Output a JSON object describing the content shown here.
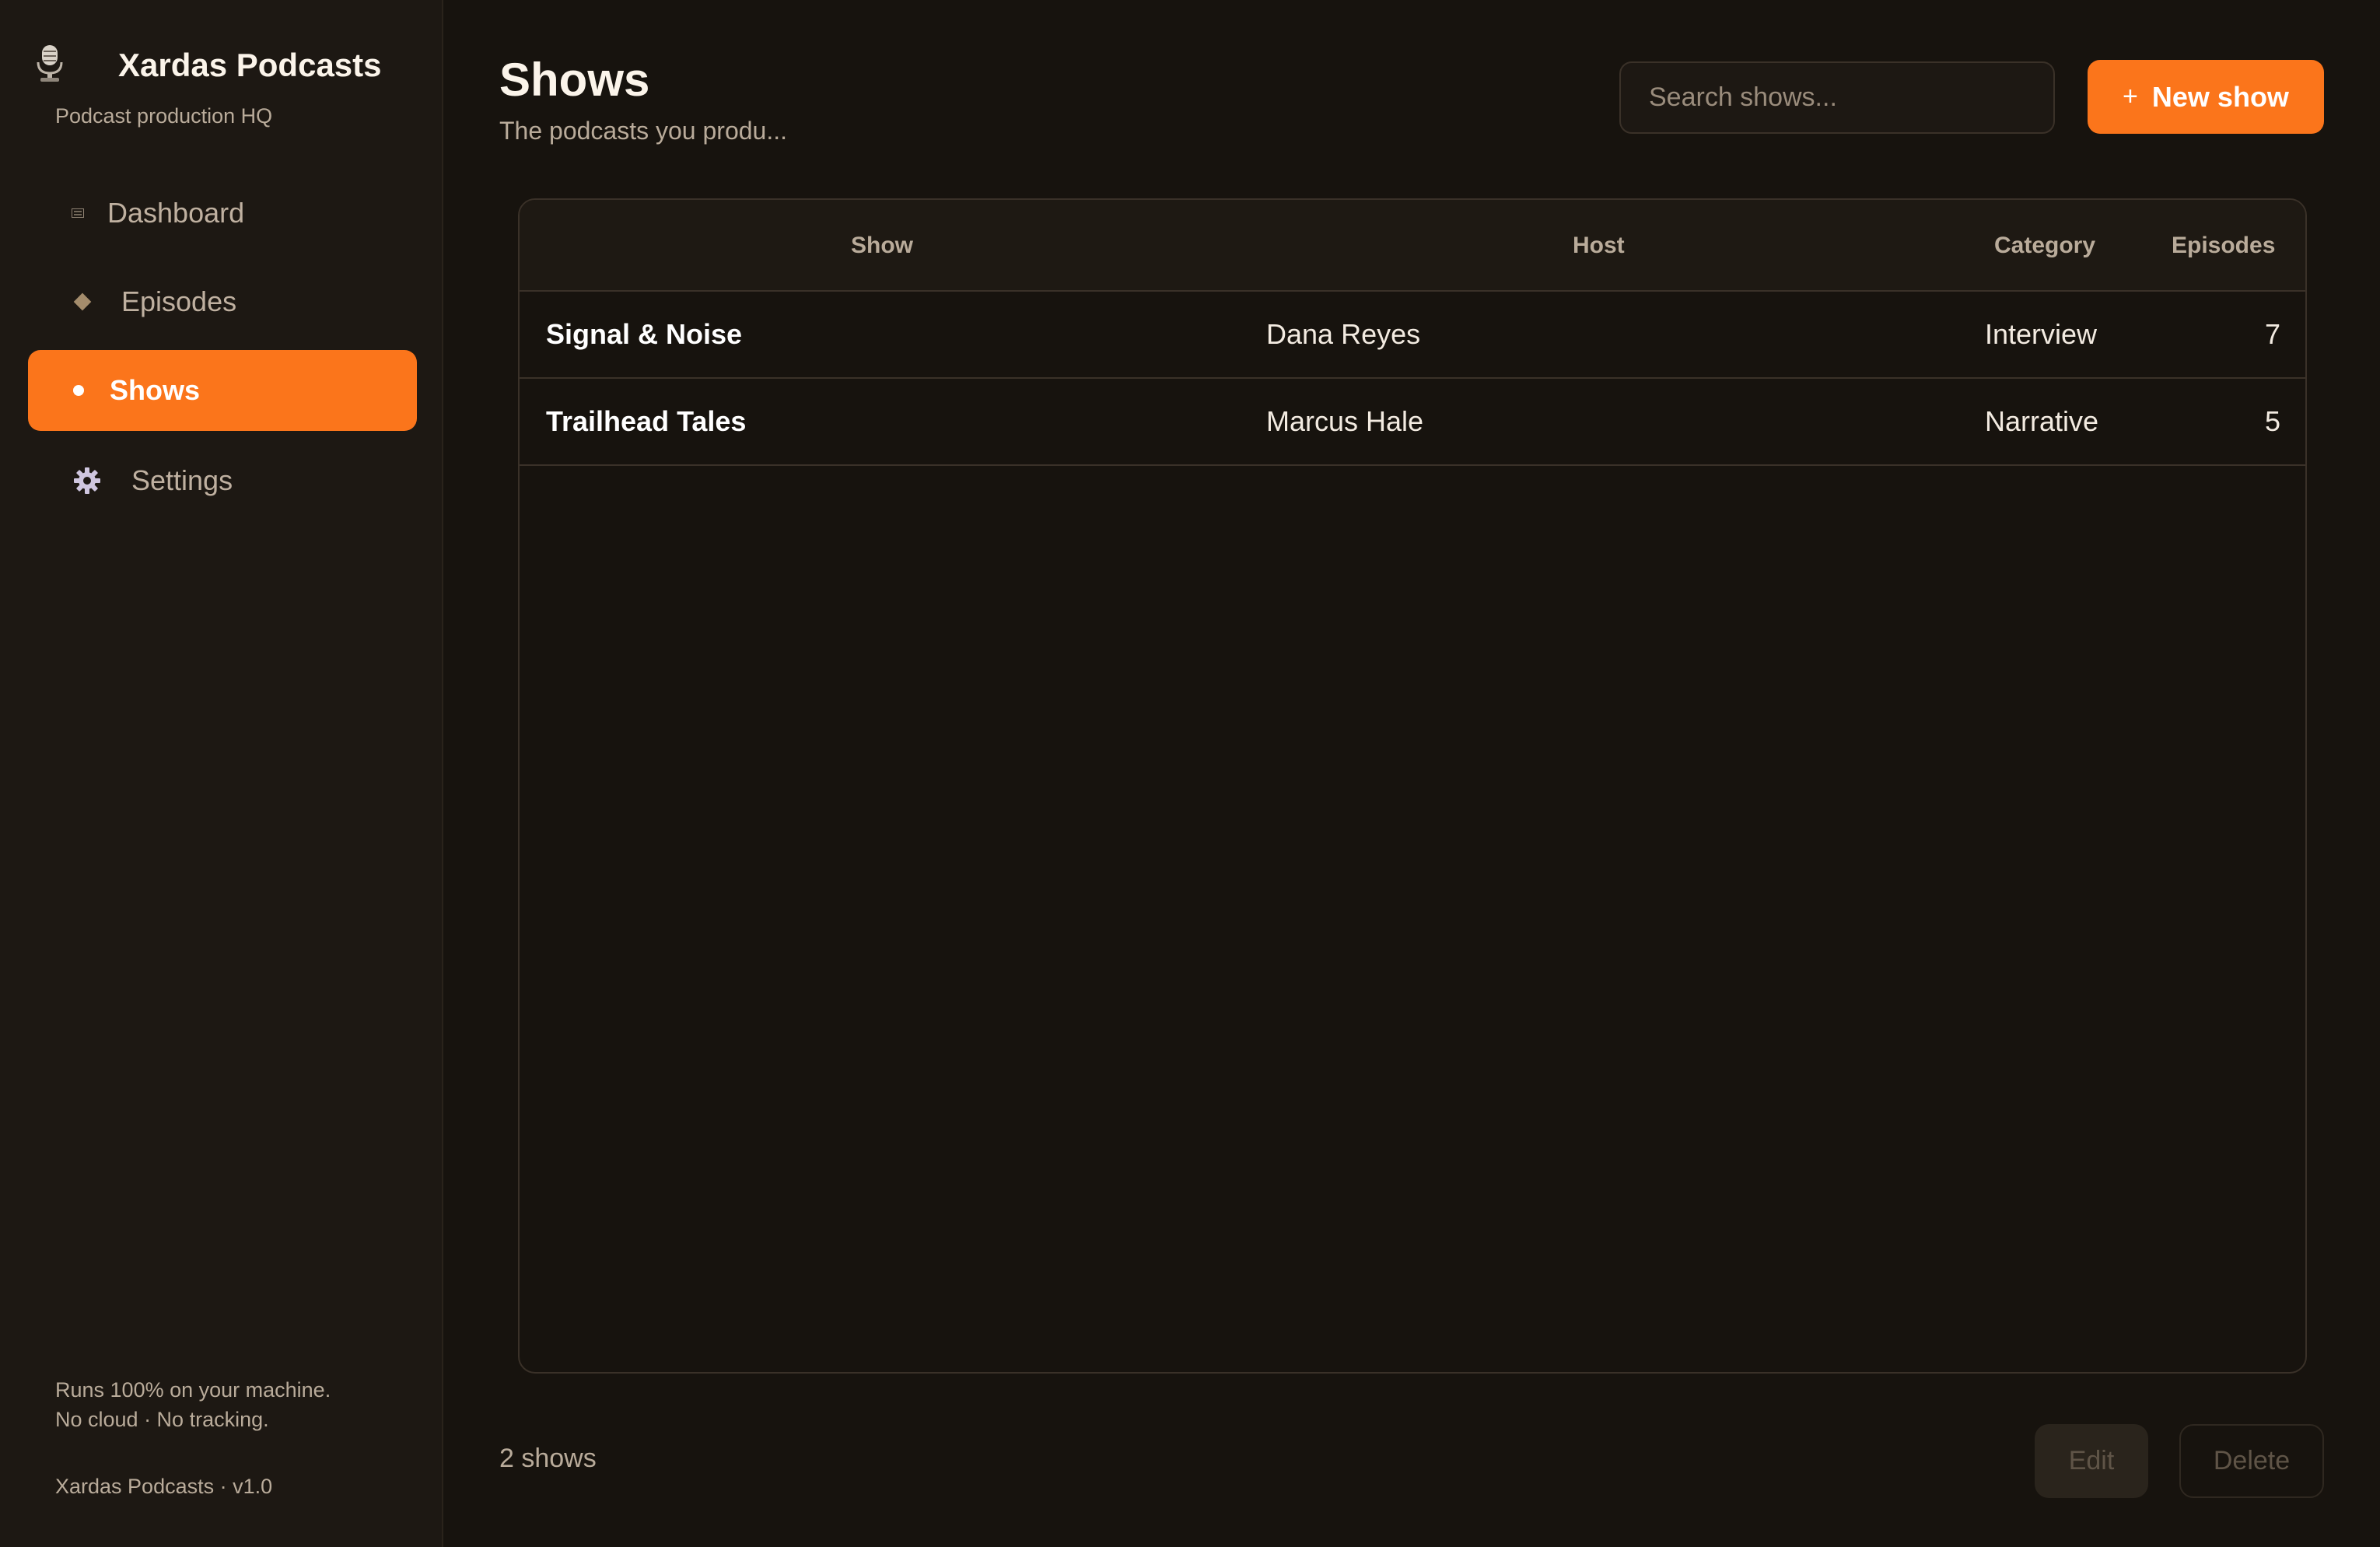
{
  "brand": {
    "title": "Xardas Podcasts",
    "subtitle": "Podcast production HQ",
    "icon": "microphone-icon"
  },
  "sidebar": {
    "items": [
      {
        "label": "Dashboard",
        "icon": "dashboard-icon",
        "active": false
      },
      {
        "label": "Episodes",
        "icon": "diamond-icon",
        "active": false
      },
      {
        "label": "Shows",
        "icon": "dot-icon",
        "active": true
      },
      {
        "label": "Settings",
        "icon": "gear-icon",
        "active": false
      }
    ],
    "note_line1": "Runs 100% on your machine.",
    "note_line2": "No cloud · No tracking.",
    "version": "Xardas Podcasts · v1.0"
  },
  "header": {
    "title": "Shows",
    "subtitle": "The podcasts you produ...",
    "search_placeholder": "Search shows...",
    "new_button_icon": "+",
    "new_button_label": "New show"
  },
  "table": {
    "columns": [
      "Show",
      "Host",
      "Category",
      "Episodes"
    ],
    "rows": [
      {
        "show": "Signal & Noise",
        "host": "Dana Reyes",
        "category": "Interview",
        "episodes": "7"
      },
      {
        "show": "Trailhead Tales",
        "host": "Marcus Hale",
        "category": "Narrative",
        "episodes": "5"
      }
    ]
  },
  "footer": {
    "count": "2 shows",
    "edit_label": "Edit",
    "delete_label": "Delete"
  },
  "colors": {
    "accent": "#fb751b",
    "background": "#17130e",
    "sidebar": "#1d1813"
  }
}
